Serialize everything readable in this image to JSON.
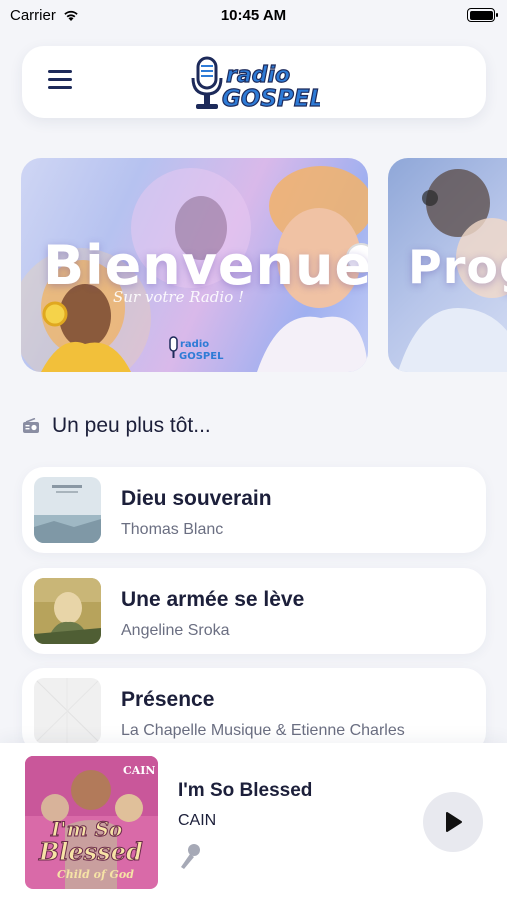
{
  "status_bar": {
    "carrier": "Carrier",
    "time": "10:45 AM"
  },
  "header": {
    "menu_icon": "hamburger-menu-icon",
    "logo_text_top": "radio",
    "logo_text_bottom": "GOSPEL"
  },
  "carousel": {
    "slides": [
      {
        "title": "Bienvenue",
        "subtitle": "Sur votre Radio !"
      },
      {
        "title": "Prog"
      }
    ]
  },
  "section": {
    "icon": "radio-icon",
    "title": "Un peu plus tôt..."
  },
  "songs": [
    {
      "title": "Dieu souverain",
      "artist": "Thomas Blanc"
    },
    {
      "title": "Une armée se lève",
      "artist": "Angeline Sroka"
    },
    {
      "title": "Présence",
      "artist": "La Chapelle Musique & Etienne Charles"
    }
  ],
  "player": {
    "title": "I'm So Blessed",
    "artist": "CAIN",
    "cover_text_top": "I'm So",
    "cover_text_mid": "Blessed",
    "cover_text_bottom": "Child of God",
    "cover_badge": "CAIN",
    "mic_icon": "microphone-icon",
    "play_icon": "play-icon"
  },
  "colors": {
    "navy": "#1d2a5a",
    "accent_blue": "#2e7bd6",
    "background": "#f4f5f9"
  }
}
